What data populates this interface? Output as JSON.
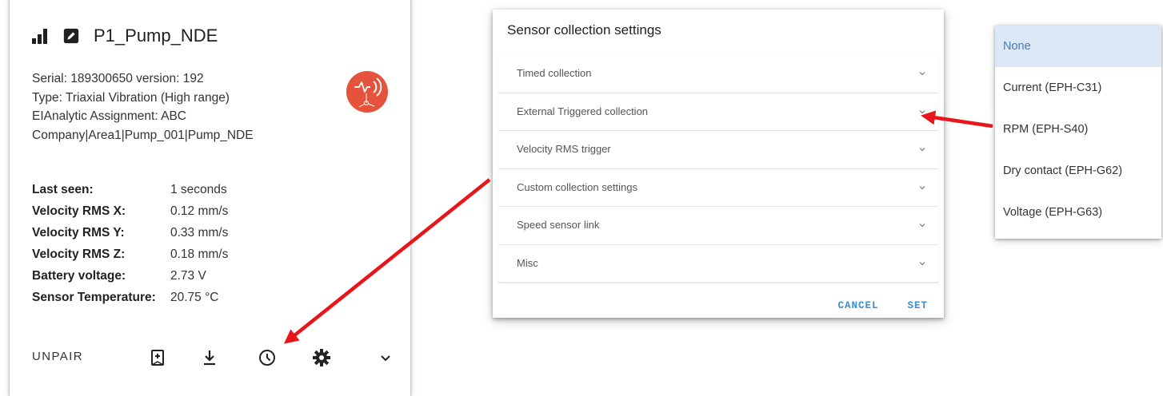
{
  "card": {
    "title": "P1_Pump_NDE",
    "info": [
      "Serial: 189300650 version: 192",
      "Type: Triaxial Vibration (High range)",
      "EIAnalytic Assignment: ABC",
      "Company|Area1|Pump_001|Pump_NDE"
    ],
    "stats": [
      {
        "label": "Last seen:",
        "value": "1 seconds"
      },
      {
        "label": "Velocity RMS X:",
        "value": "0.12 mm/s"
      },
      {
        "label": "Velocity RMS Y:",
        "value": "0.33 mm/s"
      },
      {
        "label": "Velocity RMS Z:",
        "value": "0.18 mm/s"
      },
      {
        "label": "Battery voltage:",
        "value": "2.73 V"
      },
      {
        "label": "Sensor Temperature:",
        "value": "20.75 °C"
      }
    ],
    "unpair_label": "UNPAIR",
    "icons": [
      "signal-strength-icon",
      "edit-icon",
      "sensor-type-icon",
      "bookmark-add-icon",
      "download-icon",
      "clock-icon",
      "gear-icon",
      "chevron-down-icon"
    ]
  },
  "dialog": {
    "title": "Sensor collection settings",
    "sections": [
      "Timed collection",
      "External Triggered collection",
      "Velocity RMS trigger",
      "Custom collection settings",
      "Speed sensor link",
      "Misc"
    ],
    "cancel_label": "CANCEL",
    "set_label": "SET"
  },
  "dropdown": {
    "selected": "None",
    "options": [
      "None",
      "Current (EPH-C31)",
      "RPM (EPH-S40)",
      "Dry contact (EPH-G62)",
      "Voltage (EPH-G63)"
    ]
  },
  "colors": {
    "badge": "#e6533c",
    "annotation_arrow": "#e8161b",
    "dialog_button": "#3a8fd6",
    "selected_option_bg": "#dde8f6"
  }
}
